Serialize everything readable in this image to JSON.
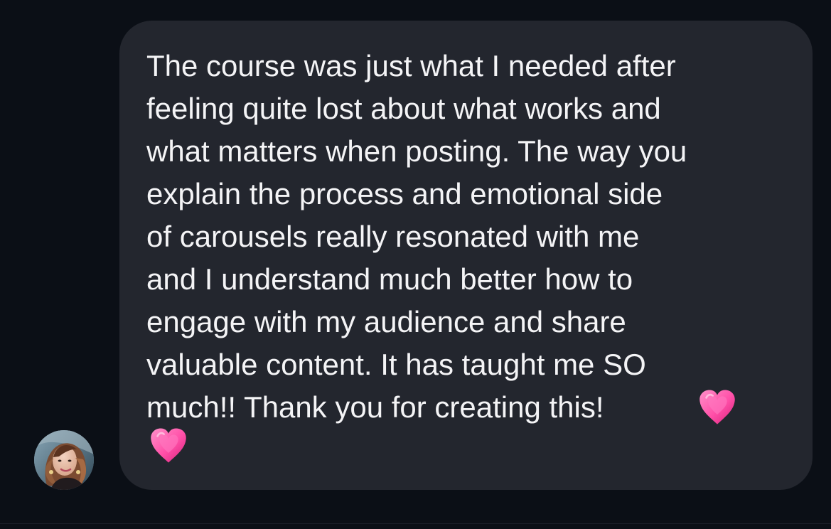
{
  "message": {
    "lines": [
      "The course was just what I needed after",
      "feeling quite lost about what works and",
      "what matters when posting. The way you",
      "explain the process and emotional side",
      "of carousels really resonated with me",
      "and I understand much better how to",
      "engage with my audience and share",
      "valuable content. It has taught me SO",
      "much!! Thank you for creating this!"
    ],
    "emojis": [
      "pink-heart-icon",
      "pink-heart-icon"
    ]
  },
  "colors": {
    "background": "#0b0f16",
    "bubble": "#23262e",
    "text": "#f4f4f6",
    "heart": "#ff4fa8"
  },
  "avatar": "user-avatar"
}
